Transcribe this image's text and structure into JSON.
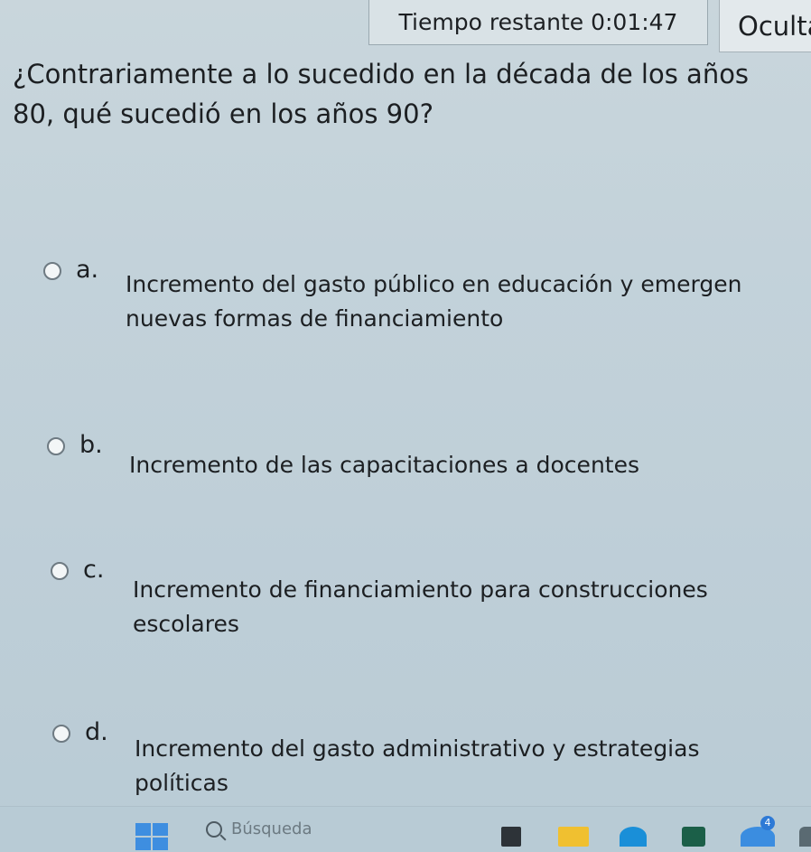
{
  "timer": {
    "label": "Tiempo restante",
    "value": "0:01:47"
  },
  "hide_button": {
    "label": "Oculta"
  },
  "question": {
    "text": "¿Contrariamente a lo sucedido en la década de los años 80, qué sucedió en los años 90?"
  },
  "options": [
    {
      "letter": "a.",
      "text": "Incremento del gasto público en educación y emergen nuevas formas de financiamiento",
      "selected": false
    },
    {
      "letter": "b.",
      "text": "Incremento de las capacitaciones a docentes",
      "selected": false
    },
    {
      "letter": "c.",
      "text": "Incremento de financiamiento para construcciones escolares",
      "selected": false
    },
    {
      "letter": "d.",
      "text": "Incremento del gasto administrativo y estrategias políticas",
      "selected": false
    }
  ],
  "taskbar": {
    "search_placeholder": "Búsqueda",
    "badge": "4",
    "icons": [
      "windows-start-icon",
      "search-icon",
      "terminal-icon",
      "file-explorer-icon",
      "edge-icon",
      "store-icon",
      "teams-icon",
      "app-icon"
    ]
  }
}
